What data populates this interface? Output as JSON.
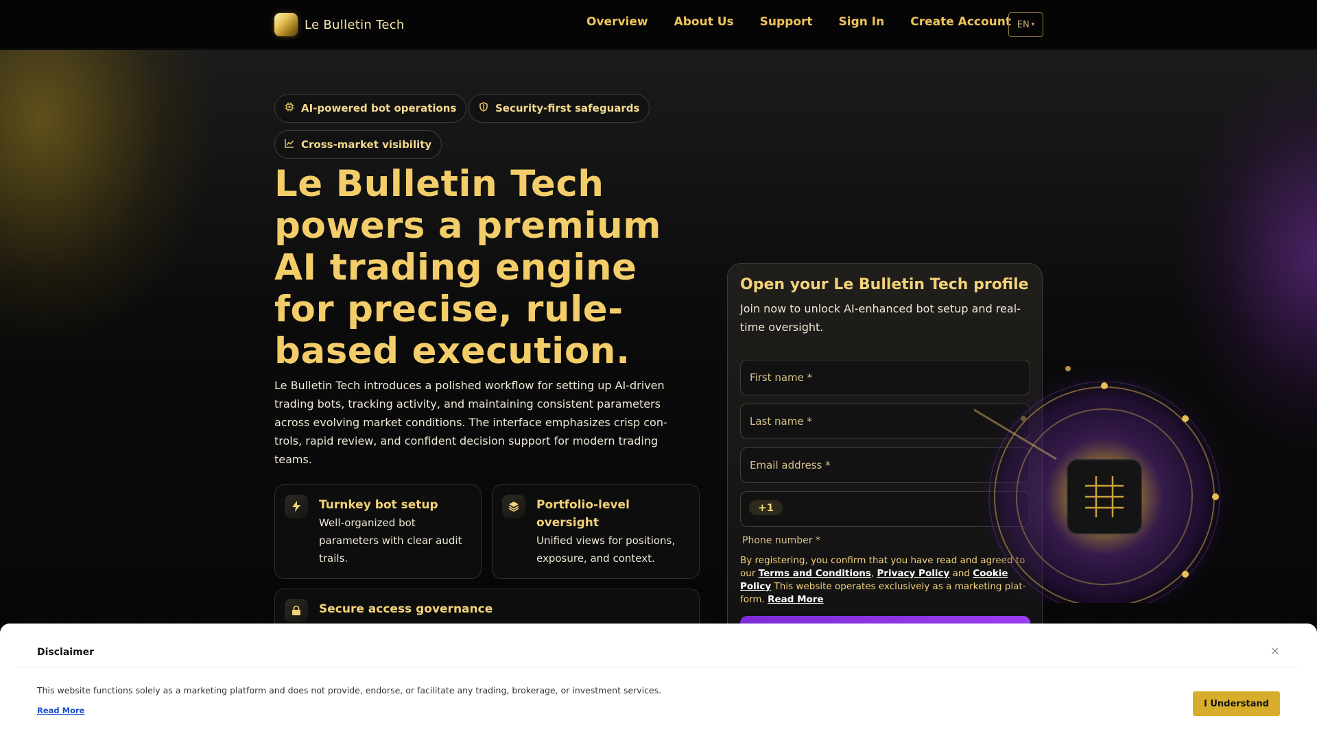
{
  "nav": {
    "brand": "Le Bulletin Tech",
    "links": [
      "Overview",
      "About Us",
      "Support",
      "Sign In",
      "Create Account"
    ],
    "language": "EN"
  },
  "hero": {
    "pills": [
      {
        "label": "AI-powered bot operations",
        "icon": "chip-icon"
      },
      {
        "label": "Security-first safeguards",
        "icon": "shield-icon"
      },
      {
        "label": "Cross-market visibility",
        "icon": "chart-line-icon"
      }
    ],
    "title": "Le Bulletin Tech powers a premium AI trading engine for precise, rule-based execution.",
    "description": "Le Bulletin Tech introduces a polished workflow for setting up AI-driven trading bots, tracking activity, and maintaining consistent parameters across evolving market conditions. The interface emphasizes crisp con-trols, rapid review, and confident decision support for modern trading teams."
  },
  "features": [
    {
      "title": "Turnkey bot setup",
      "desc": "Well-organized bot parameters with clear audit trails.",
      "icon": "lightning-icon"
    },
    {
      "title": "Portfolio-level oversight",
      "desc": "Unified views for positions, exposure, and context.",
      "icon": "layers-icon"
    },
    {
      "title": "Secure access governance",
      "desc": "",
      "icon": "lock-icon"
    }
  ],
  "signup": {
    "title": "Open your Le Bulletin Tech profile",
    "subtitle": "Join now to unlock AI-enhanced bot setup and real-time oversight.",
    "first_name_placeholder": "First name *",
    "last_name_placeholder": "Last name *",
    "email_placeholder": "Email address *",
    "dial_code": "+1",
    "phone_label": "Phone number *",
    "legal_prefix": "By registering, you confirm that you have read and agreed to our",
    "terms": "Terms and Conditions",
    "privacy": "Privacy Policy",
    "and": "and",
    "cookie": "Cookie Policy",
    "legal_suffix": "This website operates exclusively as a marketing plat-form.",
    "read_more": "Read More"
  },
  "disclaimer": {
    "title": "Disclaimer",
    "text": "This website functions solely as a marketing platform and does not provide, endorse, or facilitate any trading, brokerage, or investment services.",
    "read_more": "Read More",
    "button": "I Understand",
    "close": "×"
  },
  "colors": {
    "accent": "#f3cd69",
    "purple": "#8e35e6",
    "button": "#d9ad2c"
  }
}
